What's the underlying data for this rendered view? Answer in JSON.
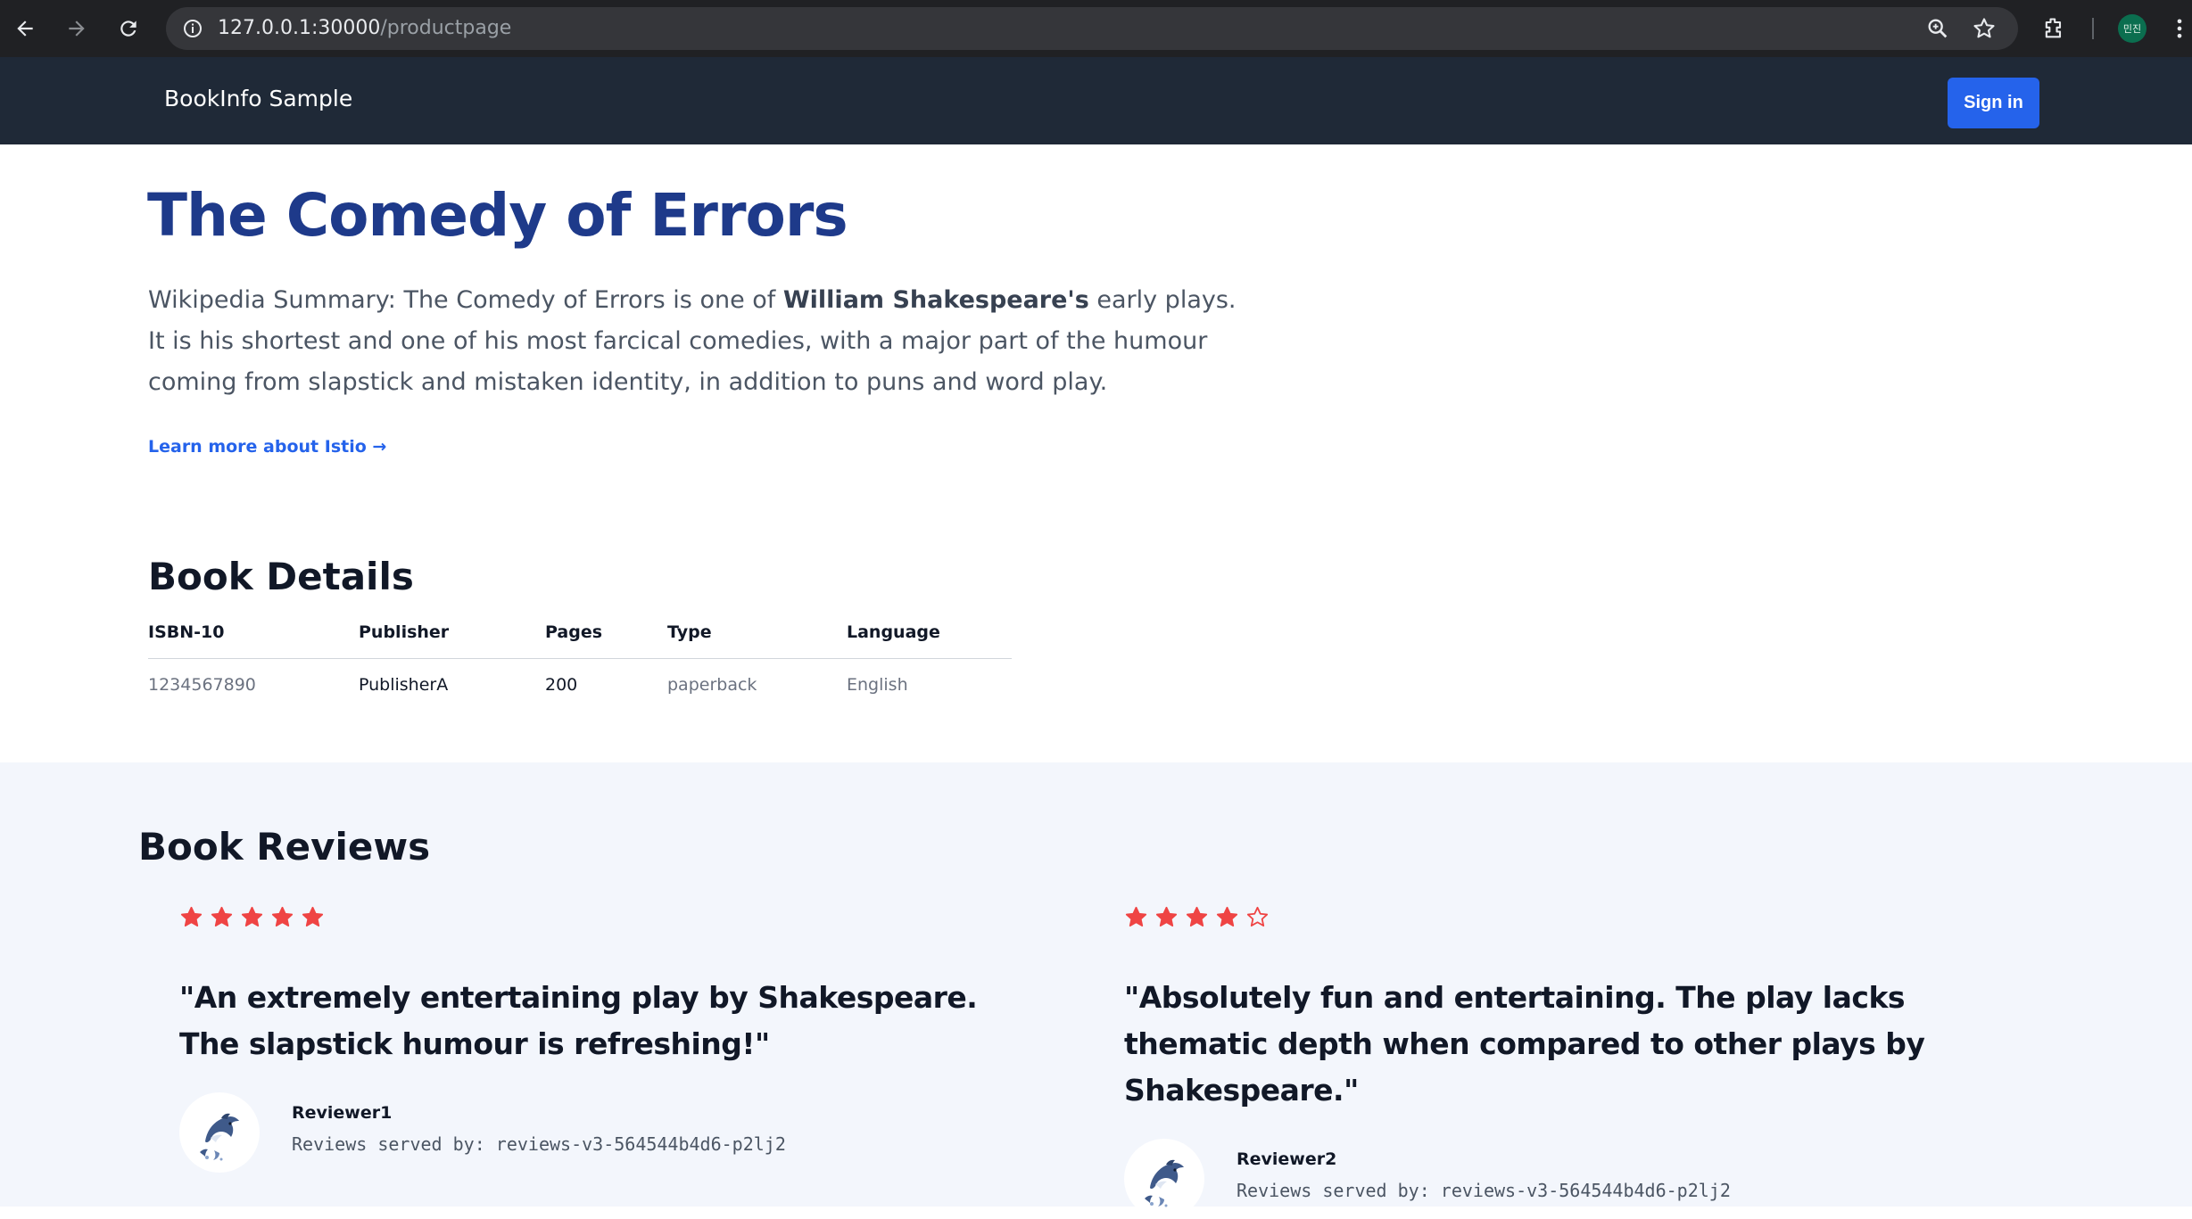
{
  "browser": {
    "url_domain": "127.0.0.1:30000",
    "url_path": "/productpage",
    "profile_initials": "민진"
  },
  "header": {
    "brand": "BookInfo Sample",
    "signin_label": "Sign in"
  },
  "product": {
    "title": "The Comedy of Errors",
    "summary_prefix": "Wikipedia Summary: The Comedy of Errors is one of ",
    "summary_bold": "William Shakespeare's",
    "summary_suffix": " early plays. It is his shortest and one of his most farcical comedies, with a major part of the humour coming from slapstick and mistaken identity, in addition to puns and word play.",
    "learn_more": "Learn more about Istio →"
  },
  "details": {
    "heading": "Book Details",
    "columns": [
      "ISBN-10",
      "Publisher",
      "Pages",
      "Type",
      "Language"
    ],
    "row": [
      "1234567890",
      "PublisherA",
      "200",
      "paperback",
      "English"
    ]
  },
  "reviews": {
    "heading": "Book Reviews",
    "star_color": "#ef4444",
    "items": [
      {
        "rating": 5,
        "max_rating": 5,
        "text": "\"An extremely entertaining play by Shakespeare. The slapstick humour is refreshing!\"",
        "reviewer": "Reviewer1",
        "served_by": "Reviews served by: reviews-v3-564544b4d6-p2lj2"
      },
      {
        "rating": 4,
        "max_rating": 5,
        "text": "\"Absolutely fun and entertaining. The play lacks thematic depth when compared to other plays by Shakespeare.\"",
        "reviewer": "Reviewer2",
        "served_by": "Reviews served by: reviews-v3-564544b4d6-p2lj2"
      }
    ]
  },
  "icons": {
    "back": "arrow-left-icon",
    "forward": "arrow-right-icon",
    "reload": "reload-icon",
    "info": "info-icon",
    "zoom": "zoom-icon",
    "bookmark": "star-bookmark-icon",
    "extensions": "extensions-icon",
    "menu": "kebab-menu-icon",
    "avatar": "dolphin-avatar-icon"
  }
}
